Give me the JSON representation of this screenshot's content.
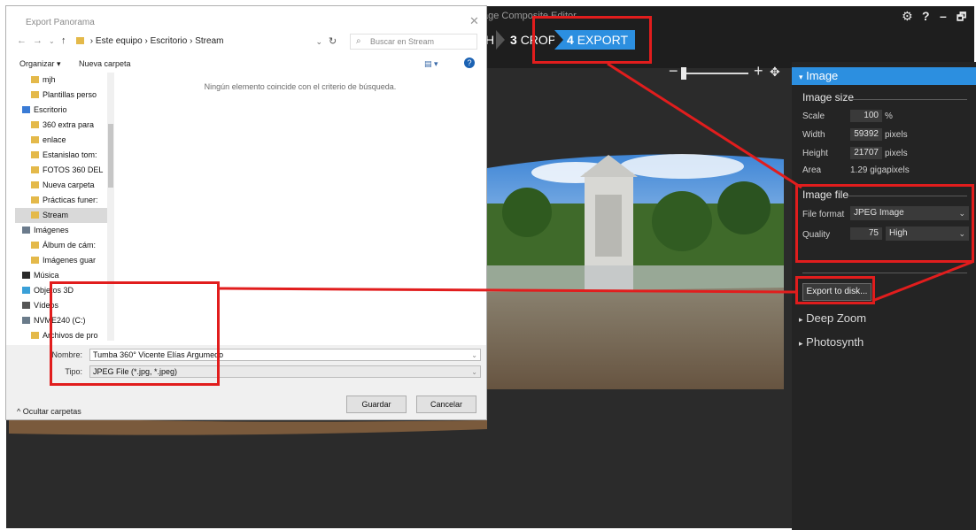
{
  "ice": {
    "window_title": "age Composite Editor",
    "window_controls": [
      "⚙",
      "?",
      "–",
      "🗗"
    ],
    "steps": [
      {
        "num": "",
        "label": "H"
      },
      {
        "num": "3",
        "label": "CROP"
      },
      {
        "num": "4",
        "label": "EXPORT"
      }
    ],
    "panel": {
      "header": "Image",
      "image_size_title": "Image size",
      "scale_label": "Scale",
      "scale_value": "100",
      "scale_unit": "%",
      "width_label": "Width",
      "width_value": "59392",
      "width_unit": "pixels",
      "height_label": "Height",
      "height_value": "21707",
      "height_unit": "pixels",
      "area_label": "Area",
      "area_value": "1.29 gigapixels",
      "image_file_title": "Image file",
      "format_label": "File format",
      "format_value": "JPEG Image",
      "quality_label": "Quality",
      "quality_value": "75",
      "quality_level": "High",
      "export_button": "Export to disk...",
      "deep_zoom": "Deep Zoom",
      "photosynth": "Photosynth"
    }
  },
  "dialog": {
    "title": "Export Panorama",
    "breadcrumb": [
      "Este equipo",
      "Escritorio",
      "Stream"
    ],
    "search_placeholder": "Buscar en Stream",
    "organize": "Organizar ▾",
    "new_folder": "Nueva carpeta",
    "empty_message": "Ningún elemento coincide con el criterio de búsqueda.",
    "tree": [
      {
        "label": "mjh",
        "type": "folder"
      },
      {
        "label": "Plantillas perso",
        "type": "folder"
      },
      {
        "label": "Escritorio",
        "type": "desktop"
      },
      {
        "label": "360 extra para",
        "type": "folder"
      },
      {
        "label": "enlace",
        "type": "folder"
      },
      {
        "label": "Estanislao tom:",
        "type": "folder"
      },
      {
        "label": "FOTOS 360 DEL",
        "type": "folder"
      },
      {
        "label": "Nueva carpeta",
        "type": "folder"
      },
      {
        "label": "Prácticas funer:",
        "type": "folder"
      },
      {
        "label": "Stream",
        "type": "folder"
      },
      {
        "label": "Imágenes",
        "type": "pictures"
      },
      {
        "label": "Álbum de cám:",
        "type": "folder"
      },
      {
        "label": "Imágenes guar",
        "type": "folder"
      },
      {
        "label": "Música",
        "type": "music"
      },
      {
        "label": "Objetos 3D",
        "type": "objects3d"
      },
      {
        "label": "Vídeos",
        "type": "videos"
      },
      {
        "label": "NVME240 (C:)",
        "type": "drive"
      },
      {
        "label": "Archivos de pro",
        "type": "folder"
      }
    ],
    "name_label": "Nombre:",
    "name_value": "Tumba 360° Vicente Elías Argumedo",
    "type_label": "Tipo:",
    "type_value": "JPEG File (*.jpg, *.jpeg)",
    "hide_folders": "Ocultar carpetas",
    "save_button": "Guardar",
    "cancel_button": "Cancelar"
  },
  "colors": {
    "accent": "#2c8fe0",
    "annotation": "#e11d1d"
  }
}
